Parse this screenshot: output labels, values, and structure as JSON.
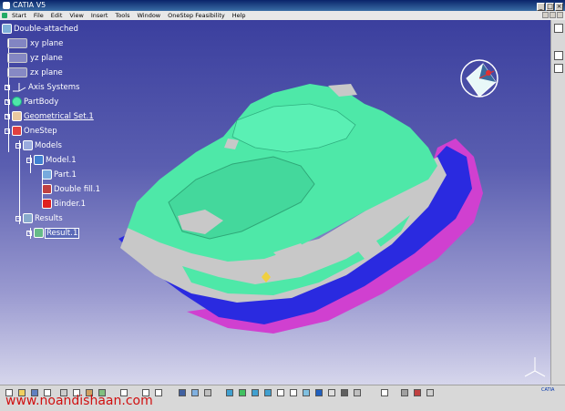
{
  "window": {
    "title": "CATIA V5"
  },
  "menu": {
    "items": [
      "Start",
      "File",
      "Edit",
      "View",
      "Insert",
      "Tools",
      "Window",
      "OneStep Feasibility",
      "Help"
    ]
  },
  "tree": {
    "root": "Double-attached",
    "nodes": [
      {
        "label": "xy plane"
      },
      {
        "label": "yz plane"
      },
      {
        "label": "zx plane"
      },
      {
        "label": "Axis Systems"
      },
      {
        "label": "PartBody"
      },
      {
        "label": "Geometrical Set.1"
      },
      {
        "label": "OneStep"
      },
      {
        "label": "Models"
      },
      {
        "label": "Model.1"
      },
      {
        "label": "Part.1"
      },
      {
        "label": "Double fill.1"
      },
      {
        "label": "Binder.1"
      },
      {
        "label": "Results"
      },
      {
        "label": "Result.1"
      }
    ]
  },
  "watermark": "www.noandishaan.com",
  "logo_text": "CATIA",
  "colors": {
    "part_green": "#4ee8a8",
    "binder_blue": "#2a2ae0",
    "edge_magenta": "#d040d0",
    "grey": "#c8c8c8"
  }
}
